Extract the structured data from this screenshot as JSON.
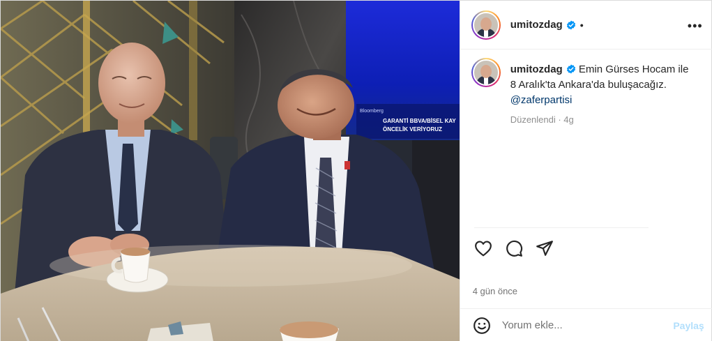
{
  "post": {
    "username": "umitozdag",
    "header_separator": "•",
    "more_label": "•••",
    "caption": {
      "line1": "Emin Gürses Hocam ile",
      "line2": "8 Aralık'ta Ankara'da buluşacağız.",
      "mention": "@zaferpartisi",
      "edited": "Düzenlendi · 4g"
    },
    "timestamp": "4 gün önce",
    "comment": {
      "placeholder": "Yorum ekle...",
      "post_label": "Paylaş"
    }
  },
  "photo": {
    "tv_headline_1": "GARANTİ BBVA/BİSEL KAY",
    "tv_headline_2": "ÖNCELİK VERİYORUZ",
    "tv_brand": "Bloomberg"
  },
  "colors": {
    "verified_blue": "#0095f6",
    "mention": "#00376b",
    "muted": "#737373",
    "post_button_disabled": "#b2dffc"
  },
  "icons": [
    "verified-badge-icon",
    "heart-icon",
    "comment-icon",
    "share-icon",
    "emoji-icon",
    "more-icon"
  ]
}
